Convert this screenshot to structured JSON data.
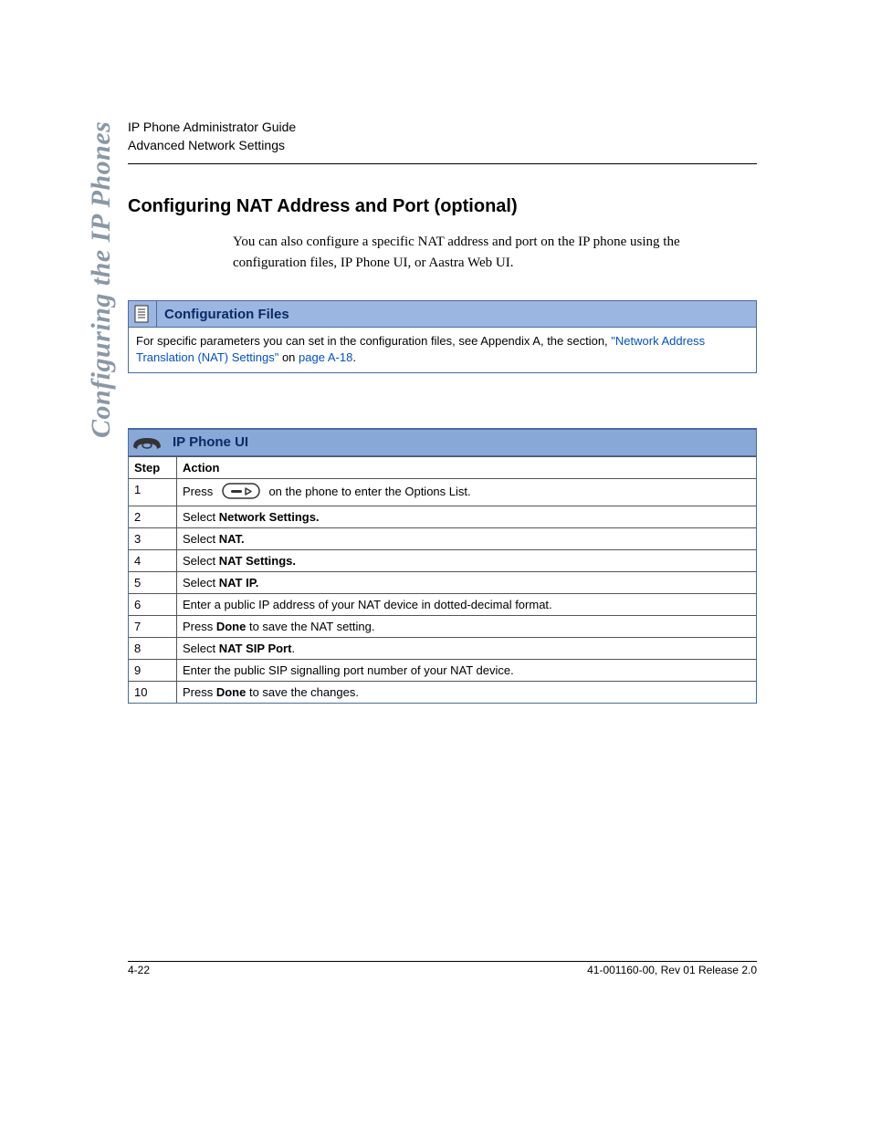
{
  "header": {
    "line1": "IP Phone Administrator Guide",
    "line2": "Advanced Network Settings"
  },
  "side_label": "Configuring the IP Phones",
  "section_heading": "Configuring NAT Address and Port (optional)",
  "intro_paragraph": "You can also configure a specific NAT address and port on the IP phone using the configuration files, IP Phone UI, or Aastra Web UI.",
  "config_files_box": {
    "title": "Configuration Files",
    "body_prefix": "For specific parameters you can set in the configuration files, see Appendix A, the section, ",
    "link_text": "\"Network Address Translation (NAT) Settings\"",
    "body_mid": " on ",
    "page_ref": "page A-18",
    "body_suffix": "."
  },
  "phone_ui_box": {
    "title": "IP Phone UI",
    "columns": {
      "step": "Step",
      "action": "Action"
    },
    "rows": [
      {
        "step": "1",
        "action_pre": "Press ",
        "has_key_icon": true,
        "action_post": " on the phone to enter the Options List."
      },
      {
        "step": "2",
        "action_pre": "Select ",
        "bold": "Network Settings.",
        "action_post": ""
      },
      {
        "step": "3",
        "action_pre": "Select ",
        "bold": "NAT.",
        "action_post": ""
      },
      {
        "step": "4",
        "action_pre": "Select ",
        "bold": "NAT Settings.",
        "action_post": ""
      },
      {
        "step": "5",
        "action_pre": "Select ",
        "bold": "NAT IP.",
        "action_post": ""
      },
      {
        "step": "6",
        "action_pre": "Enter a public IP address of your NAT device in dotted-decimal format.",
        "bold": "",
        "action_post": ""
      },
      {
        "step": "7",
        "action_pre": "Press ",
        "bold": "Done",
        "action_post": " to save the NAT setting."
      },
      {
        "step": "8",
        "action_pre": "Select ",
        "bold": "NAT SIP Port",
        "action_post": "."
      },
      {
        "step": "9",
        "action_pre": "Enter the public SIP signalling port number of your NAT device.",
        "bold": "",
        "action_post": ""
      },
      {
        "step": "10",
        "action_pre": "Press ",
        "bold": "Done",
        "action_post": " to save the changes."
      }
    ]
  },
  "footer": {
    "left": "4-22",
    "right": "41-001160-00, Rev 01 Release 2.0"
  }
}
